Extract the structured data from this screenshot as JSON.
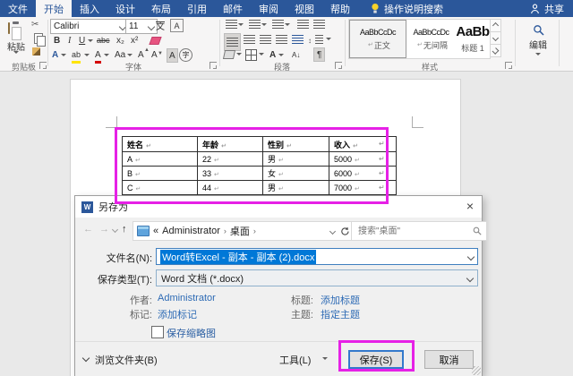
{
  "colors": {
    "accent": "#2b579a",
    "annotation": "#e621e6",
    "selection": "#0078d7",
    "link": "#2e6bb5"
  },
  "titlebar": {
    "tabs": [
      "文件",
      "开始",
      "插入",
      "设计",
      "布局",
      "引用",
      "邮件",
      "审阅",
      "视图",
      "帮助"
    ],
    "active_tab": "开始",
    "tell_me": "操作说明搜索",
    "share": "共享"
  },
  "ribbon": {
    "clipboard": {
      "label": "剪贴板",
      "paste": "粘贴"
    },
    "font": {
      "label": "字体",
      "family": "Calibri",
      "size": "11",
      "bold": "B",
      "italic": "I",
      "underline": "U",
      "strikethrough": "abc",
      "subscript": "x₂",
      "superscript": "x²",
      "phonetic": "文",
      "char_border": "A",
      "text_effects": "A",
      "highlight": "ab",
      "font_color": "A",
      "change_case": "Aa",
      "grow_font": "A",
      "shrink_font": "A",
      "char_shading": "A",
      "enclose_char": "字"
    },
    "paragraph": {
      "label": "段落",
      "sort": "A↓",
      "pilcrow": "¶",
      "line_spacing": "↕"
    },
    "styles": {
      "label": "样式",
      "items": [
        {
          "preview": "AaBbCcDc",
          "name": "正文"
        },
        {
          "preview": "AaBbCcDc",
          "name": "无间隔"
        },
        {
          "preview": "AaBb",
          "name": "标题 1"
        }
      ]
    },
    "editing": {
      "label": "编辑"
    }
  },
  "document": {
    "table": {
      "headers": [
        "姓名",
        "年龄",
        "性别",
        "收入"
      ],
      "rows": [
        [
          "A",
          "22",
          "男",
          "5000"
        ],
        [
          "B",
          "33",
          "女",
          "6000"
        ],
        [
          "C",
          "44",
          "男",
          "7000"
        ]
      ]
    }
  },
  "dialog": {
    "title": "另存为",
    "close": "×",
    "nav": {
      "back": "←",
      "forward": "→",
      "up": "↑",
      "breadcrumb_collapse": "«",
      "breadcrumb_items": [
        "Administrator",
        "桌面"
      ],
      "breadcrumb_separator": "›",
      "search_placeholder": "搜索\"桌面\""
    },
    "filename": {
      "label": "文件名(N):",
      "value": "Word转Excel - 副本 - 副本 (2).docx"
    },
    "savetype": {
      "label": "保存类型(T):",
      "value": "Word 文档 (*.docx)"
    },
    "meta": {
      "author_label": "作者:",
      "author_value": "Administrator",
      "tags_label": "标记:",
      "tags_value": "添加标记",
      "title_label": "标题:",
      "title_value": "添加标题",
      "subject_label": "主题:",
      "subject_value": "指定主题"
    },
    "thumbnail_label": "保存缩略图",
    "browse_folders": "浏览文件夹(B)",
    "tools_label": "工具(L)",
    "save_label": "保存(S)",
    "cancel_label": "取消"
  },
  "icons": {
    "paragraph_mark": "↵"
  }
}
